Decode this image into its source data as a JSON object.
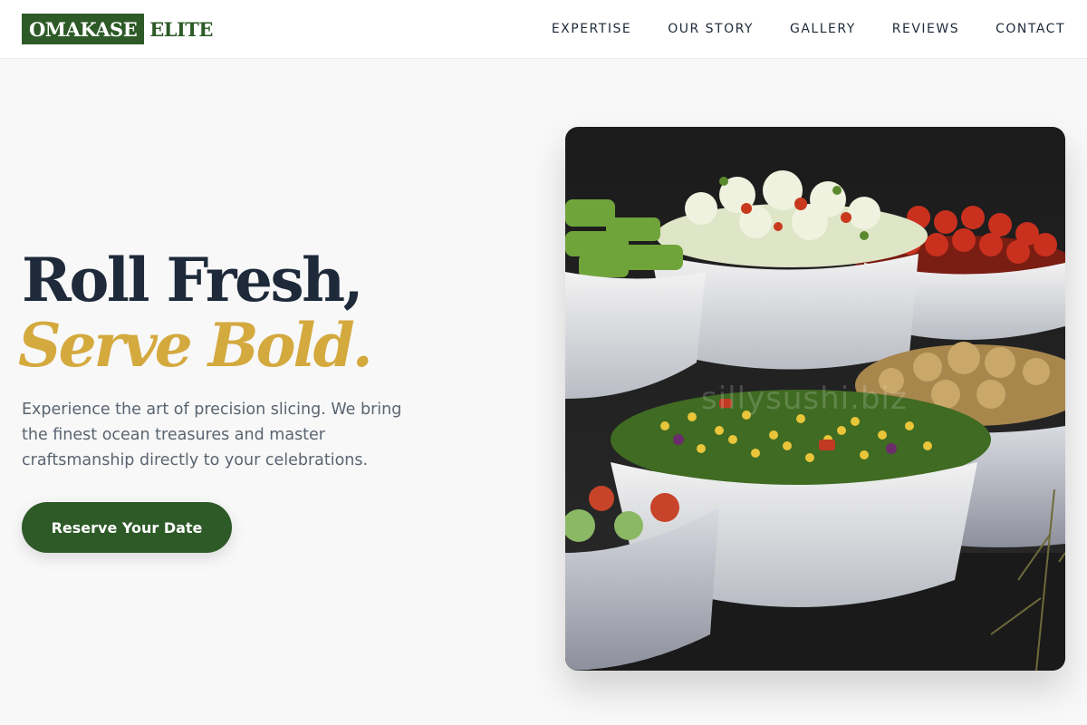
{
  "header": {
    "logo": {
      "boxed": "OMAKASE",
      "rest": "ELITE"
    },
    "nav": [
      "EXPERTISE",
      "OUR STORY",
      "GALLERY",
      "REVIEWS",
      "CONTACT"
    ]
  },
  "hero": {
    "title_line1": "Roll Fresh,",
    "title_line2": "Serve Bold.",
    "description": "Experience the art of precision slicing. We bring the finest ocean treasures and master craftsmanship directly to your celebrations.",
    "cta_label": "Reserve Your Date",
    "image_watermark": "sillysushi.biz"
  },
  "colors": {
    "brand_green": "#2d5a27",
    "accent_gold": "#d4a93e",
    "heading_navy": "#1e2a3a",
    "body_gray": "#5a6470"
  }
}
